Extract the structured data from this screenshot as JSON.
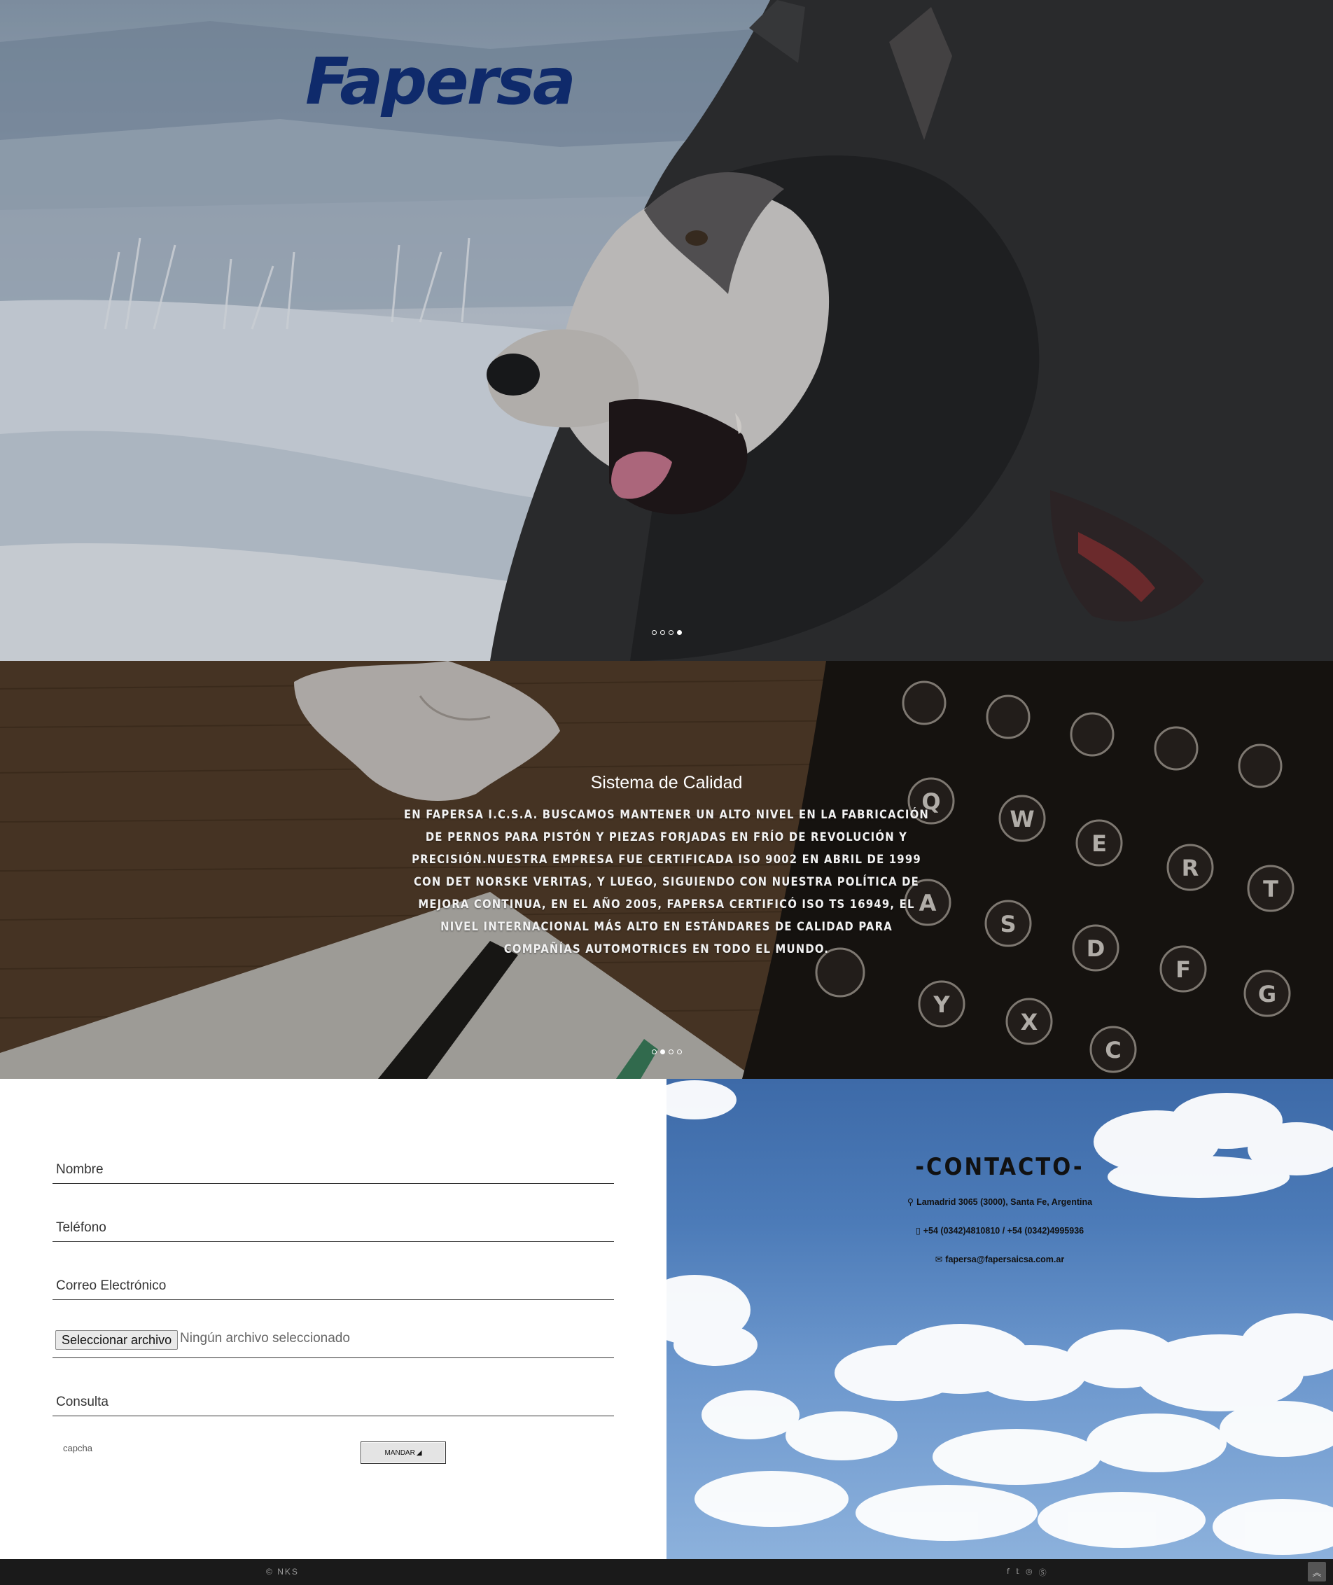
{
  "brand": {
    "logo_text": "Fapersa"
  },
  "hero": {
    "slides": 4,
    "active_slide": 4
  },
  "quality": {
    "title": "Sistema de Calidad",
    "body": "En Fapersa I.C.S.A. buscamos mantener un alto nivel en la fabricación de pernos para pistón y piezas forjadas en frío de revolución y precisión.Nuestra empresa fue certificada ISO 9002 en abril de 1999 con Det Norske Veritas, y luego, siguiendo con nuestra política de mejora continua, en el año 2005, Fapersa certificó ISO TS 16949, el nivel internacional más alto en estándares de calidad para compañías automotrices en todo el mundo.",
    "slides": 4,
    "active_slide": 2
  },
  "form": {
    "name_placeholder": "Nombre",
    "phone_placeholder": "Teléfono",
    "email_placeholder": "Correo Electrónico",
    "file_button": "Seleccionar archivo",
    "file_status": "Ningún archivo seleccionado",
    "query_placeholder": "Consulta",
    "captcha_label": "capcha",
    "send_label": "MANDAR"
  },
  "contact": {
    "title": "-CONTACTO-",
    "address": "Lamadrid 3065 (3000), Santa Fe, Argentina",
    "phone": "+54 (0342)4810810 / +54 (0342)4995936",
    "email": "fapersa@fapersaicsa.com.ar",
    "icons": [
      "map-marker-icon",
      "mobile-phone-icon",
      "envelope-icon"
    ]
  },
  "footer": {
    "credit": "NKS",
    "social_icons": [
      "facebook-icon",
      "twitter-icon",
      "dribbble-icon",
      "skype-icon"
    ],
    "back_to_top_icon": "double-chevron-up-icon"
  },
  "colors": {
    "brand_blue": "#0f2a6b",
    "footer_bg": "#1a1a1a",
    "sky_blue": "#4c7bb8"
  }
}
